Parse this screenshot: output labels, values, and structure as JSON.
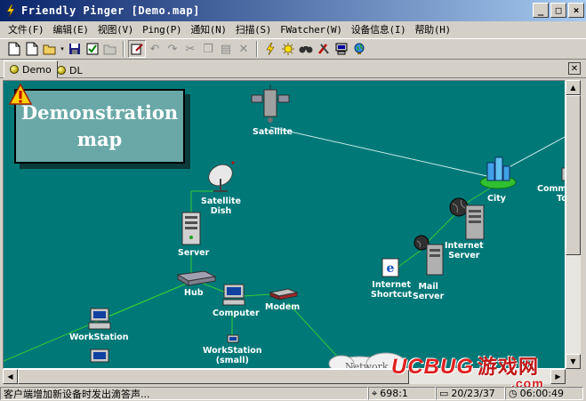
{
  "window": {
    "title": "Friendly Pinger [Demo.map]",
    "buttons": {
      "minimize": "_",
      "maximize": "□",
      "close": "×"
    }
  },
  "menu": [
    "文件(F)",
    "编辑(E)",
    "视图(V)",
    "Ping(P)",
    "通知(N)",
    "扫描(S)",
    "FWatcher(W)",
    "设备信息(I)",
    "帮助(H)"
  ],
  "toolbar": {
    "icons": [
      "new-map-icon",
      "new-doc-icon",
      "open-icon",
      "save-icon",
      "properties-icon",
      "folder-icon",
      "edit-icon",
      "undo-icon",
      "redo-icon",
      "cut-icon",
      "copy-icon",
      "paste-icon",
      "delete-icon",
      "ping-icon",
      "alert-icon",
      "find-icon",
      "tools-icon",
      "computer-icon",
      "globe-icon"
    ]
  },
  "tabs": [
    {
      "label": "Demo",
      "active": true
    },
    {
      "label": "DL",
      "active": false
    }
  ],
  "map": {
    "title_line1": "Demonstration",
    "title_line2": "map",
    "nodes": {
      "satellite": "Satellite",
      "satellite_dish": [
        "Satellite",
        "Dish"
      ],
      "server": "Server",
      "hub": "Hub",
      "computer": "Computer",
      "modem": "Modem",
      "workstation": "WorkStation",
      "workstation_small": [
        "WorkStation",
        "(small)"
      ],
      "city": "City",
      "internet_server": [
        "Internet",
        "Server"
      ],
      "internet_shortcut": [
        "Internet",
        "Shortcut"
      ],
      "mail_server": [
        "Mail",
        "Server"
      ],
      "community": [
        "Commu",
        "To"
      ],
      "network_cloud": "Network"
    },
    "colors": {
      "background": "#007878",
      "link": "#33cc33",
      "satellite_link": "#c8e8e8"
    }
  },
  "status": {
    "message": "客户端增加新设备时发出滴答声...",
    "coords": "698:1",
    "date": "20/23/37",
    "time": "06:00:49"
  },
  "watermark": {
    "brand": "UCBUG",
    "cn": "游戏网",
    "domain": ".com"
  }
}
